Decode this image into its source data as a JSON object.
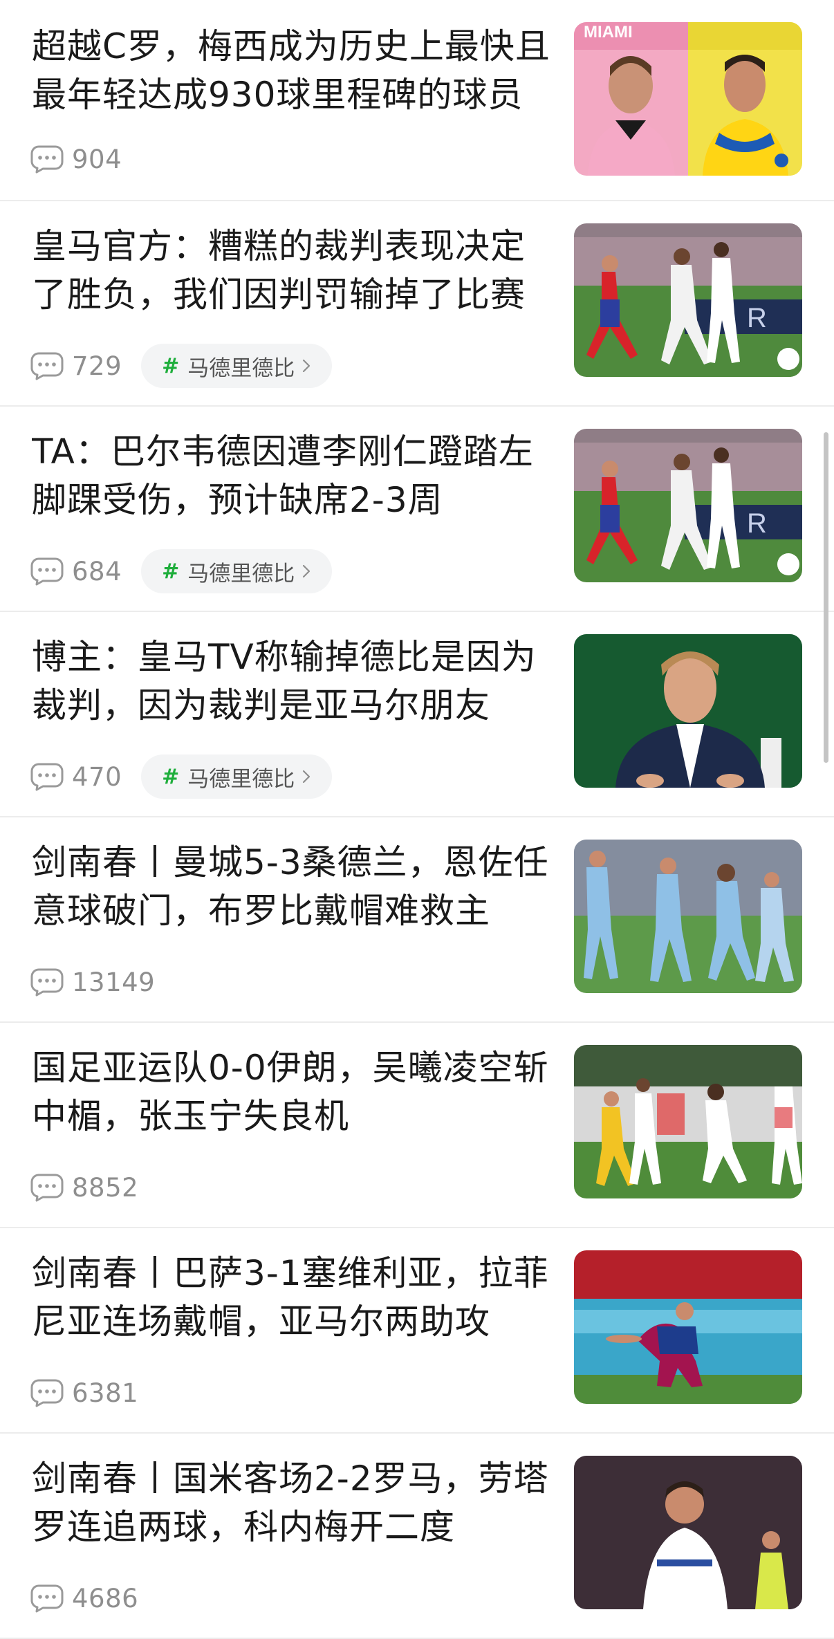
{
  "feed": {
    "items": [
      {
        "title": "超越C罗，梅西成为历史上最快且最年轻达成930球里程碑的球员",
        "comments": "904",
        "tag": "",
        "image": "messi-ronaldo-portrait"
      },
      {
        "title": "皇马官方：糟糕的裁判表现决定了胜负，我们因判罚输掉了比赛",
        "comments": "729",
        "tag": "马德里德比",
        "image": "derby-match-action"
      },
      {
        "title": "TA：巴尔韦德因遭李刚仁蹬踏左脚踝受伤，预计缺席2-3周",
        "comments": "684",
        "tag": "马德里德比",
        "image": "derby-match-action"
      },
      {
        "title": "博主：皇马TV称输掉德比是因为裁判，因为裁判是亚马尔朋友",
        "comments": "470",
        "tag": "马德里德比",
        "image": "tv-presenter"
      },
      {
        "title": "剑南春丨曼城5-3桑德兰，恩佐任意球破门，布罗比戴帽难救主",
        "comments": "13149",
        "tag": "",
        "image": "man-city-match"
      },
      {
        "title": "国足亚运队0-0伊朗，吴曦凌空斩中楣，张玉宁失良机",
        "comments": "8852",
        "tag": "",
        "image": "china-iran-match"
      },
      {
        "title": "剑南春丨巴萨3-1塞维利亚，拉菲尼亚连场戴帽，亚马尔两助攻",
        "comments": "6381",
        "tag": "",
        "image": "barca-player-kneeling"
      },
      {
        "title": "剑南春丨国米客场2-2罗马，劳塔罗连追两球，科内梅开二度",
        "comments": "4686",
        "tag": "",
        "image": "inter-player-celebrating"
      }
    ]
  },
  "colors": {
    "title_text": "#1a1a1a",
    "meta_text": "#8e8e8e",
    "tag_hash": "#1fae3c",
    "tag_background": "#f3f4f5",
    "divider": "#ececec"
  }
}
